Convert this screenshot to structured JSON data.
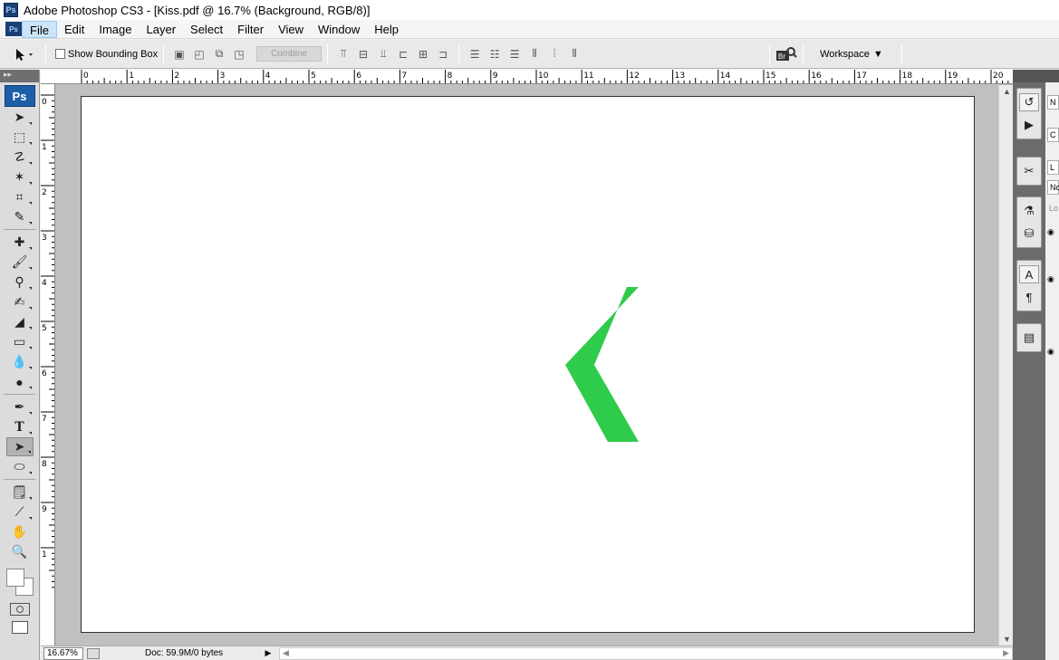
{
  "window": {
    "title": "Adobe Photoshop CS3 - [Kiss.pdf @ 16.7% (Background, RGB/8)]",
    "app_badge": "Ps"
  },
  "menu": [
    "File",
    "Edit",
    "Image",
    "Layer",
    "Select",
    "Filter",
    "View",
    "Window",
    "Help"
  ],
  "options": {
    "show_bounding_box": "Show Bounding Box",
    "combine": "Combine",
    "workspace": "Workspace",
    "bridge_badge": "Br"
  },
  "toolbox": {
    "badge": "Ps"
  },
  "ruler": {
    "h_labels": [
      "0",
      "1",
      "2",
      "3",
      "4",
      "5",
      "6",
      "7",
      "8",
      "9",
      "10",
      "11",
      "12",
      "13",
      "14",
      "15",
      "16",
      "17",
      "18",
      "19",
      "20"
    ],
    "v_labels": [
      "0",
      "1",
      "2",
      "3",
      "4",
      "5",
      "6",
      "7",
      "8",
      "9",
      "1"
    ]
  },
  "canvas": {
    "shape": "chevron-left",
    "shape_color": "#2ecc4a"
  },
  "status": {
    "zoom": "16.67%",
    "doc_info": "Doc: 59.9M/0 bytes"
  },
  "right_panel_tabs": [
    "N",
    "C",
    "L",
    "No",
    "Lo"
  ]
}
